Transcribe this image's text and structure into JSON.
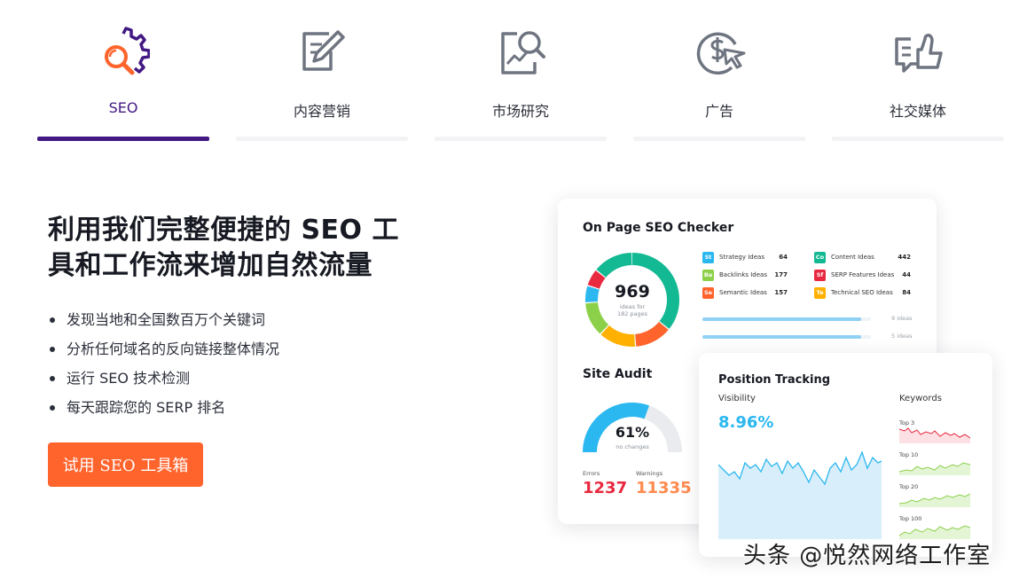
{
  "tabs": [
    {
      "label": "SEO",
      "icon": "seo-gear-search-icon",
      "active": true
    },
    {
      "label": "内容营销",
      "icon": "edit-document-icon",
      "active": false
    },
    {
      "label": "市场研究",
      "icon": "market-research-icon",
      "active": false
    },
    {
      "label": "广告",
      "icon": "dollar-cursor-icon",
      "active": false
    },
    {
      "label": "社交媒体",
      "icon": "social-thumbs-up-icon",
      "active": false
    }
  ],
  "colors": {
    "accent": "#421983",
    "cta": "#ff642d",
    "seo_orange": "#ff642d",
    "blue": "#2bb7f0"
  },
  "hero": {
    "headline_line1": "利用我们完整便捷的 SEO 工",
    "headline_line2": "具和工作流来增加自然流量",
    "features": [
      "发现当地和全国数百万个关键词",
      "分析任何域名的反向链接整体情况",
      "运行 SEO 技术检测",
      "每天跟踪您的 SERP 排名"
    ],
    "cta_label": "试用 SEO 工具箱"
  },
  "on_page": {
    "title": "On Page SEO Checker",
    "donut_value": "969",
    "donut_caption_1": "ideas for",
    "donut_caption_2": "182 pages",
    "ideas": [
      {
        "badge": "St",
        "name": "Strategy Ideas",
        "value": "64",
        "color": "#2bb7f0"
      },
      {
        "badge": "Co",
        "name": "Content Ideas",
        "value": "442",
        "color": "#13b993"
      },
      {
        "badge": "Ba",
        "name": "Backlinks Ideas",
        "value": "177",
        "color": "#8cd04a"
      },
      {
        "badge": "Sf",
        "name": "SERP Features Ideas",
        "value": "44",
        "color": "#e8293f"
      },
      {
        "badge": "Se",
        "name": "Semantic Ideas",
        "value": "157",
        "color": "#ff642d"
      },
      {
        "badge": "Te",
        "name": "Technical SEO Ideas",
        "value": "84",
        "color": "#ffb000"
      }
    ],
    "progress": [
      {
        "label": "9 ideas",
        "fraction": 0.94
      },
      {
        "label": "5 ideas",
        "fraction": 0.94
      }
    ]
  },
  "site_audit": {
    "title": "Site Audit",
    "percent": "61%",
    "caption": "no changes",
    "gauge_fraction": 0.61,
    "errors_label": "Errors",
    "errors_value": "1237",
    "warnings_label": "Warnings",
    "warnings_value": "11335"
  },
  "position_tracking": {
    "title": "Position Tracking",
    "visibility_label": "Visibility",
    "visibility_value": "8.96%",
    "keywords_label": "Keywords",
    "keyword_tiers": [
      "Top 3",
      "Top 10",
      "Top 20",
      "Top 100"
    ]
  },
  "watermark": "头条 @悦然网络工作室"
}
